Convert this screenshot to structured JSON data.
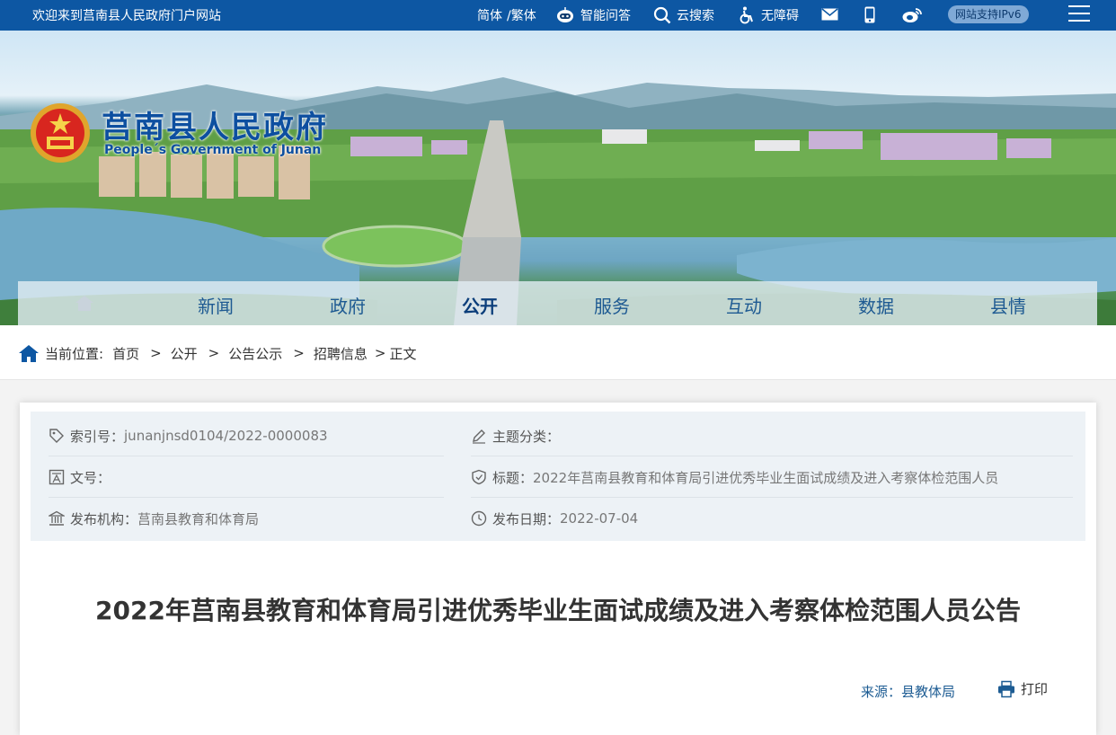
{
  "topbar": {
    "welcome": "欢迎来到莒南县人民政府门户网站",
    "simplified": "简体",
    "traditional": "/繁体",
    "qa": "智能问答",
    "search": "云搜索",
    "accessibility": "无障碍",
    "ipv6": "网站支持IPv6",
    "icons": [
      "robot-icon",
      "search-icon",
      "wheelchair-icon",
      "mail-icon",
      "mobile-icon",
      "weibo-icon",
      "menu-icon"
    ]
  },
  "header": {
    "title": "莒南县人民政府",
    "subtitle": "People´s Government of Junan"
  },
  "nav": {
    "items": [
      {
        "label": "新闻"
      },
      {
        "label": "政府"
      },
      {
        "label": "公开",
        "active": true
      },
      {
        "label": "服务"
      },
      {
        "label": "互动"
      },
      {
        "label": "数据"
      },
      {
        "label": "县情"
      }
    ]
  },
  "breadcrumb": {
    "prefix": "当前位置:",
    "items": [
      "首页",
      "公开",
      "公告公示",
      "招聘信息"
    ],
    "separators": [
      ">",
      ">",
      ">",
      ">"
    ],
    "current": "正文"
  },
  "meta": {
    "index_label": "索引号：",
    "index_value": "junanjnsd0104/2022-0000083",
    "topic_label": "主题分类：",
    "topic_value": "",
    "docno_label": "文号：",
    "docno_value": "",
    "title_label": "标题：",
    "title_value": "2022年莒南县教育和体育局引进优秀毕业生面试成绩及进入考察体检范围人员",
    "org_label": "发布机构：",
    "org_value": "莒南县教育和体育局",
    "date_label": "发布日期：",
    "date_value": "2022-07-04"
  },
  "article": {
    "title": "2022年莒南县教育和体育局引进优秀毕业生面试成绩及进入考察体检范围人员公告",
    "source": "来源：县教体局",
    "print": "打印"
  },
  "colors": {
    "topbar": "#0d57a3",
    "title_blue": "#0d4fa0",
    "nav_text": "#1e5a92"
  }
}
